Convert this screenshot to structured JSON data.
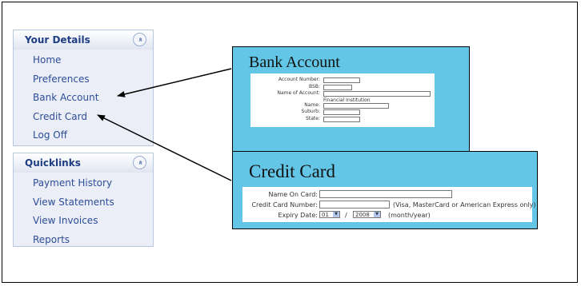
{
  "your_details": {
    "title": "Your Details",
    "collapse_glyph": "«",
    "items": [
      "Home",
      "Preferences",
      "Bank Account",
      "Credit Card",
      "Log Off"
    ]
  },
  "quicklinks": {
    "title": "Quicklinks",
    "collapse_glyph": "«",
    "items": [
      "Payment History",
      "View Statements",
      "View Invoices",
      "Reports"
    ]
  },
  "bank_account": {
    "title": "Bank Account",
    "labels": {
      "account_number": "Account Number:",
      "bsb": "BSB:",
      "name_of_account": "Name of Account:",
      "financial_institution": "Financial Institution",
      "name": "Name:",
      "suburb": "Suburb:",
      "state": "State:"
    }
  },
  "credit_card": {
    "title": "Credit Card",
    "name_on_card_label": "Name On Card:",
    "card_number_label": "Credit Card Number:",
    "card_types_note": "(Visa, MasterCard or American Express only)",
    "expiry_label": "Expiry Date:",
    "expiry_month": "01",
    "expiry_separator": "/",
    "expiry_year": "2008",
    "expiry_hint": "(month/year)"
  },
  "colors": {
    "window_bg": "#63c6e6",
    "panel_bg": "#ebeef6",
    "link": "#2c4d98"
  }
}
